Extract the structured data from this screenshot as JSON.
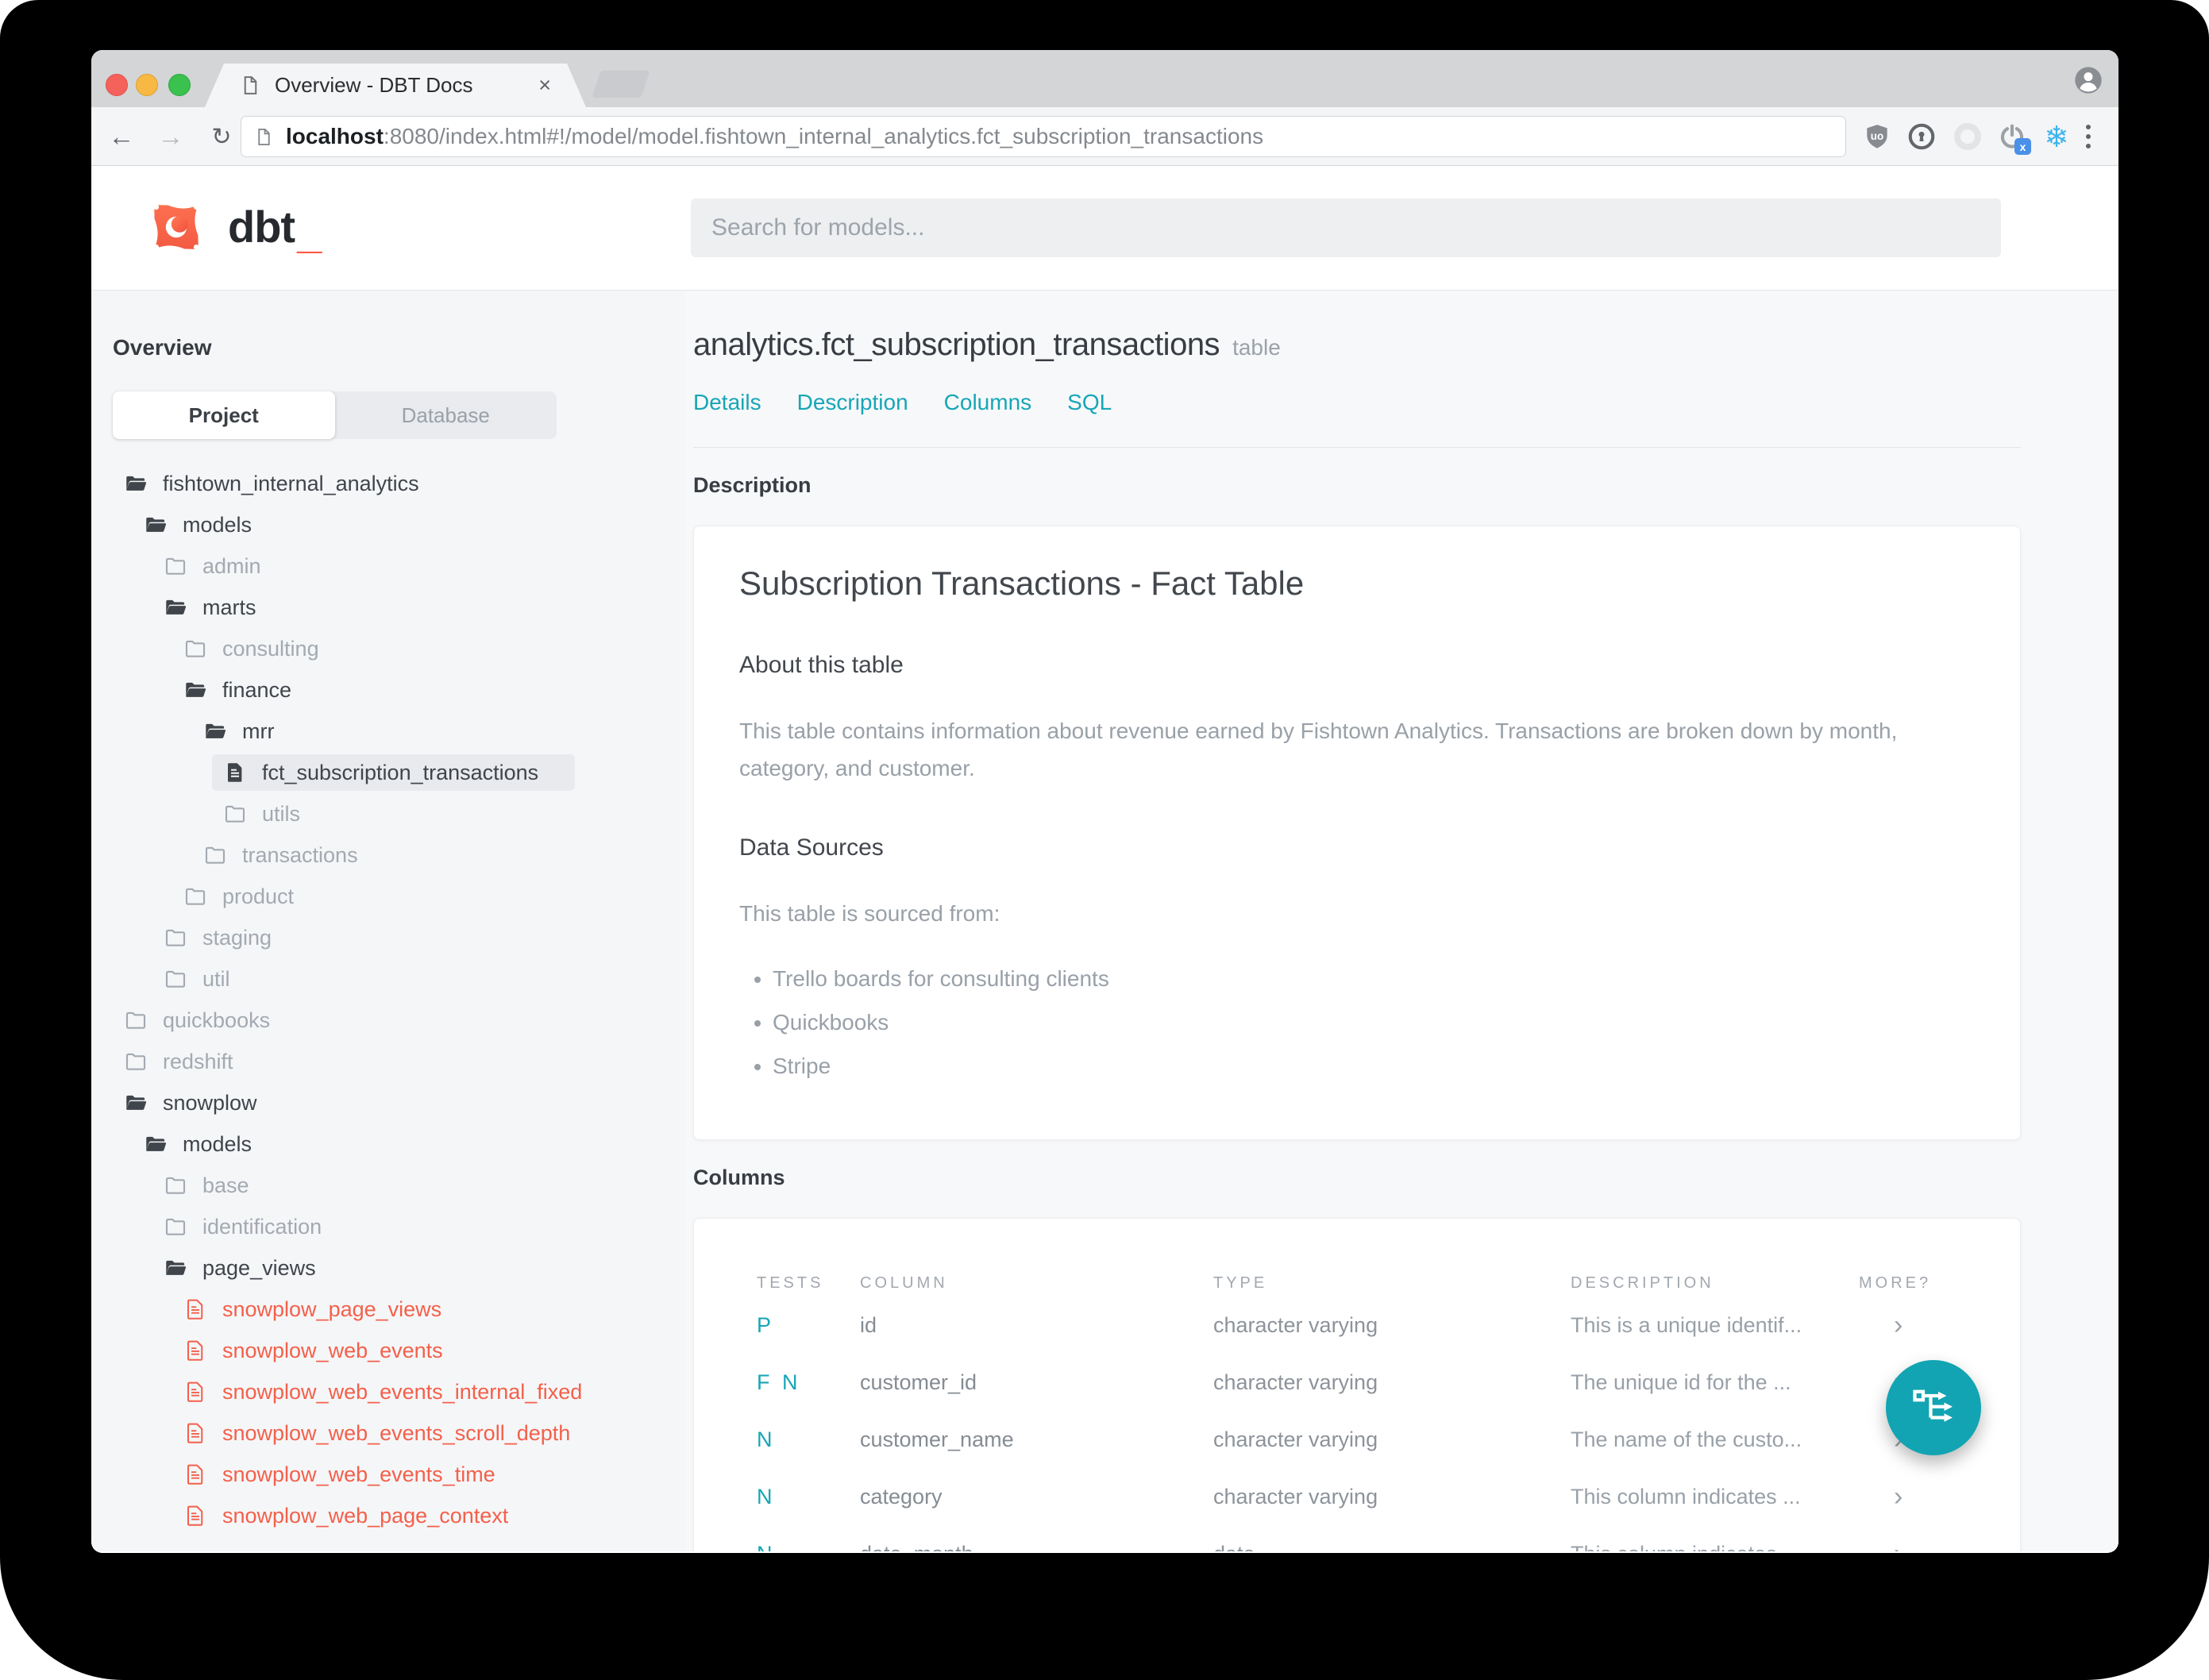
{
  "browser": {
    "tab_title": "Overview - DBT Docs",
    "tab_close": "×",
    "nav": {
      "back": "←",
      "forward": "→",
      "reload": "↻"
    },
    "url": {
      "host": "localhost",
      "rest": ":8080/index.html#!/model/model.fishtown_internal_analytics.fct_subscription_transactions"
    },
    "extensions": {
      "snowflake_glyph": "❄",
      "x_badge": "x",
      "ublock_label": "uo"
    }
  },
  "app_header": {
    "brand": "dbt",
    "brand_cursor": "_",
    "search_placeholder": "Search for models..."
  },
  "sidebar": {
    "title": "Overview",
    "view_tabs": [
      {
        "label": "Project",
        "active": true
      },
      {
        "label": "Database",
        "active": false
      }
    ],
    "tree": [
      {
        "label": "fishtown_internal_analytics",
        "level": 0,
        "icon": "folder-open",
        "variant": "default"
      },
      {
        "label": "models",
        "level": 1,
        "icon": "folder-open",
        "variant": "default"
      },
      {
        "label": "admin",
        "level": 2,
        "icon": "folder",
        "variant": "muted"
      },
      {
        "label": "marts",
        "level": 2,
        "icon": "folder-open",
        "variant": "default"
      },
      {
        "label": "consulting",
        "level": 3,
        "icon": "folder",
        "variant": "muted"
      },
      {
        "label": "finance",
        "level": 3,
        "icon": "folder-open",
        "variant": "default"
      },
      {
        "label": "mrr",
        "level": 4,
        "icon": "folder-open",
        "variant": "default"
      },
      {
        "label": "fct_subscription_transactions",
        "level": 5,
        "icon": "file",
        "variant": "selected"
      },
      {
        "label": "utils",
        "level": 5,
        "icon": "folder",
        "variant": "muted"
      },
      {
        "label": "transactions",
        "level": 4,
        "icon": "folder",
        "variant": "muted"
      },
      {
        "label": "product",
        "level": 3,
        "icon": "folder",
        "variant": "muted"
      },
      {
        "label": "staging",
        "level": 2,
        "icon": "folder",
        "variant": "muted"
      },
      {
        "label": "util",
        "level": 2,
        "icon": "folder",
        "variant": "muted"
      },
      {
        "label": "quickbooks",
        "level": 0,
        "icon": "folder",
        "variant": "muted"
      },
      {
        "label": "redshift",
        "level": 0,
        "icon": "folder",
        "variant": "muted"
      },
      {
        "label": "snowplow",
        "level": 0,
        "icon": "folder-open",
        "variant": "default"
      },
      {
        "label": "models",
        "level": 1,
        "icon": "folder-open",
        "variant": "default"
      },
      {
        "label": "base",
        "level": 2,
        "icon": "folder",
        "variant": "muted"
      },
      {
        "label": "identification",
        "level": 2,
        "icon": "folder",
        "variant": "muted"
      },
      {
        "label": "page_views",
        "level": 2,
        "icon": "folder-open",
        "variant": "default"
      },
      {
        "label": "snowplow_page_views",
        "level": 3,
        "icon": "file-outline",
        "variant": "error"
      },
      {
        "label": "snowplow_web_events",
        "level": 3,
        "icon": "file-outline",
        "variant": "error"
      },
      {
        "label": "snowplow_web_events_internal_fixed",
        "level": 3,
        "icon": "file-outline",
        "variant": "error"
      },
      {
        "label": "snowplow_web_events_scroll_depth",
        "level": 3,
        "icon": "file-outline",
        "variant": "error"
      },
      {
        "label": "snowplow_web_events_time",
        "level": 3,
        "icon": "file-outline",
        "variant": "error"
      },
      {
        "label": "snowplow_web_page_context",
        "level": 3,
        "icon": "file-outline",
        "variant": "error"
      }
    ]
  },
  "main": {
    "title": "analytics.fct_subscription_transactions",
    "badge": "table",
    "nav_links": [
      "Details",
      "Description",
      "Columns",
      "SQL"
    ],
    "description_heading": "Description",
    "description_card": {
      "h1": "Subscription Transactions - Fact Table",
      "about_heading": "About this table",
      "about_text": "This table contains information about revenue earned by Fishtown Analytics. Transactions are broken down by month, category, and customer.",
      "sources_heading": "Data Sources",
      "sources_intro": "This table is sourced from:",
      "sources": [
        "Trello boards for consulting clients",
        "Quickbooks",
        "Stripe"
      ]
    },
    "columns_heading": "Columns",
    "columns_table": {
      "headers": [
        "TESTS",
        "COLUMN",
        "TYPE",
        "DESCRIPTION",
        "MORE?"
      ],
      "more_glyph": "›",
      "rows": [
        {
          "tests": "P",
          "column": "id",
          "type": "character varying",
          "description": "This is a unique identif..."
        },
        {
          "tests": "F N",
          "column": "customer_id",
          "type": "character varying",
          "description": "The unique id for the ..."
        },
        {
          "tests": "N",
          "column": "customer_name",
          "type": "character varying",
          "description": "The name of the custo..."
        },
        {
          "tests": "N",
          "column": "category",
          "type": "character varying",
          "description": "This column indicates ..."
        },
        {
          "tests": "N",
          "column": "date_month",
          "type": "date",
          "description": "This column indicates ..."
        }
      ]
    }
  },
  "colors": {
    "accent_teal": "#12a4b2",
    "brand_orange": "#ff5a47",
    "error_red": "#f4604a"
  }
}
